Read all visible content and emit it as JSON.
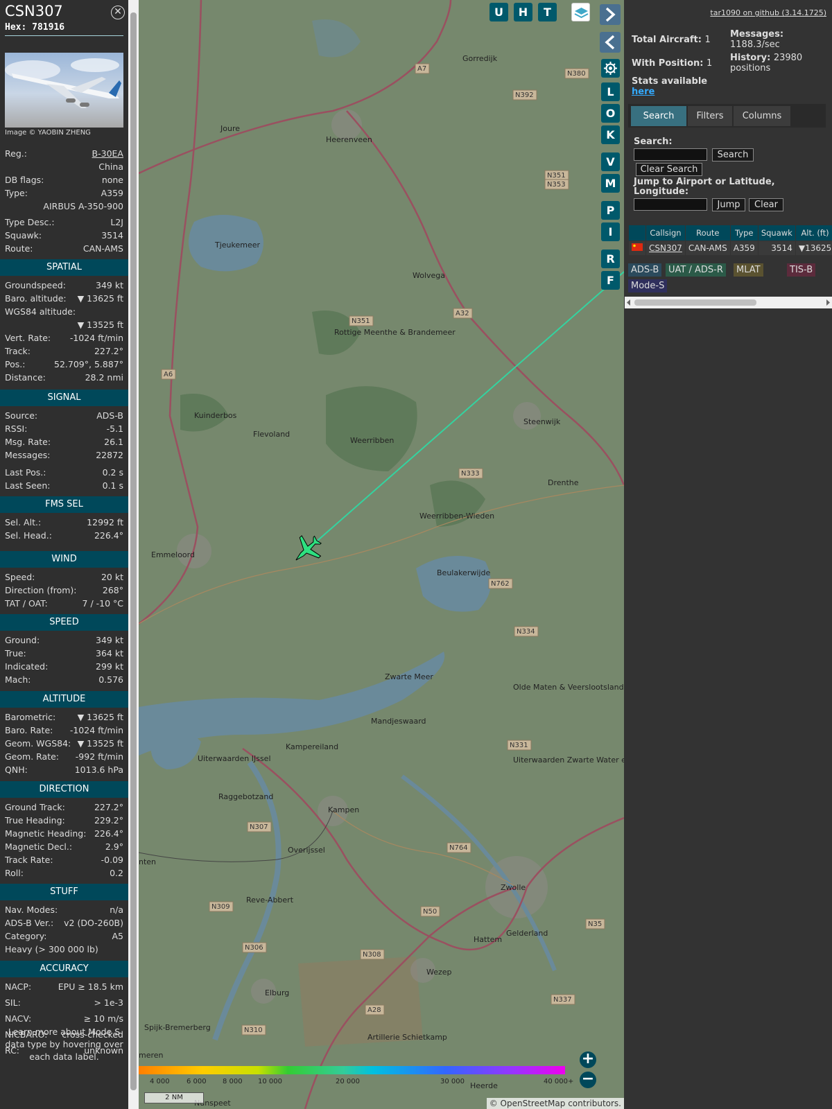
{
  "info": {
    "callsign": "CSN307",
    "hex_label": "Hex:",
    "hex": "781916",
    "close_glyph": "✕",
    "image_credit": "Image © YAOBIN ZHENG",
    "general": [
      {
        "k": "Reg.:",
        "v": "B-30EA"
      },
      {
        "k": "",
        "v": "China"
      },
      {
        "k": "DB flags:",
        "v": "none"
      },
      {
        "k": "Type:",
        "v": "A359"
      },
      {
        "k": "",
        "v": "AIRBUS A-350-900"
      },
      {
        "k": "Type Desc.:",
        "v": "L2J"
      },
      {
        "k": "Squawk:",
        "v": "3514"
      },
      {
        "k": "Route:",
        "v": "CAN-AMS"
      }
    ],
    "spatial_title": "SPATIAL",
    "spatial": [
      {
        "k": "Groundspeed:",
        "v": "349 kt"
      },
      {
        "k": "Baro. altitude:",
        "v": "▼ 13625 ft"
      },
      {
        "k": "WGS84 altitude:",
        "v": ""
      },
      {
        "k": "",
        "v": "▼ 13525 ft"
      },
      {
        "k": "Vert. Rate:",
        "v": "-1024 ft/min"
      },
      {
        "k": "Track:",
        "v": "227.2°"
      },
      {
        "k": "Pos.:",
        "v": "52.709°, 5.887°"
      },
      {
        "k": "Distance:",
        "v": "28.2 nmi"
      }
    ],
    "signal_title": "SIGNAL",
    "signal": [
      {
        "k": "Source:",
        "v": "ADS-B"
      },
      {
        "k": "RSSI:",
        "v": "-5.1"
      },
      {
        "k": "Msg. Rate:",
        "v": "26.1"
      },
      {
        "k": "Messages:",
        "v": "22872"
      },
      {
        "k": "Last Pos.:",
        "v": "0.2 s"
      },
      {
        "k": "Last Seen:",
        "v": "0.1 s"
      }
    ],
    "fms_title": "FMS SEL",
    "fms": [
      {
        "k": "Sel. Alt.:",
        "v": "12992 ft"
      },
      {
        "k": "Sel. Head.:",
        "v": "226.4°"
      }
    ],
    "wind_title": "WIND",
    "wind": [
      {
        "k": "Speed:",
        "v": "20 kt"
      },
      {
        "k": "Direction (from):",
        "v": "268°"
      },
      {
        "k": "TAT / OAT:",
        "v": "7 / -10 °C"
      }
    ],
    "speed_title": "SPEED",
    "speed": [
      {
        "k": "Ground:",
        "v": "349 kt"
      },
      {
        "k": "True:",
        "v": "364 kt"
      },
      {
        "k": "Indicated:",
        "v": "299 kt"
      },
      {
        "k": "Mach:",
        "v": "0.576"
      }
    ],
    "altitude_title": "ALTITUDE",
    "altitude": [
      {
        "k": "Barometric:",
        "v": "▼ 13625 ft"
      },
      {
        "k": "Baro. Rate:",
        "v": "-1024 ft/min"
      },
      {
        "k": "Geom. WGS84:",
        "v": "▼ 13525 ft"
      },
      {
        "k": "Geom. Rate:",
        "v": "-992 ft/min"
      },
      {
        "k": "QNH:",
        "v": "1013.6 hPa"
      }
    ],
    "direction_title": "DIRECTION",
    "direction": [
      {
        "k": "Ground Track:",
        "v": "227.2°"
      },
      {
        "k": "True Heading:",
        "v": "229.2°"
      },
      {
        "k": "Magnetic Heading:",
        "v": "226.4°"
      },
      {
        "k": "Magnetic Decl.:",
        "v": "2.9°"
      },
      {
        "k": "Track Rate:",
        "v": "-0.09"
      },
      {
        "k": "Roll:",
        "v": "0.2"
      }
    ],
    "stuff_title": "STUFF",
    "stuff": [
      {
        "k": "Nav. Modes:",
        "v": "n/a"
      },
      {
        "k": "ADS-B Ver.:",
        "v": "v2 (DO-260B)"
      },
      {
        "k": "Category:",
        "v": "A5"
      },
      {
        "k": "Heavy (> 300 000 lb)",
        "v": ""
      }
    ],
    "accuracy_title": "ACCURACY",
    "accuracy": [
      {
        "k": "NACP:",
        "v": "EPU ≥ 18.5 km"
      },
      {
        "k": "SIL:",
        "v": "> 1e-3"
      },
      {
        "k": "NACV:",
        "v": "≥ 10 m/s"
      },
      {
        "k": "NICBARO:",
        "v": "cross-checked"
      },
      {
        "k": "RC:",
        "v": "unknown"
      }
    ],
    "note": "Learn more about Mode S data type by hovering over each data label."
  },
  "map": {
    "top_buttons": [
      "U",
      "H",
      "T"
    ],
    "side_buttons": [
      "L",
      "O",
      "K",
      "V",
      "M",
      "P",
      "I",
      "R",
      "F"
    ],
    "places": [
      "Gorredijk",
      "Heerenveen",
      "Joure",
      "Tjeukemeer",
      "Wolvega",
      "Rottige Meenthe & Brandemeer",
      "Steenwijk",
      "Weerribben",
      "Kuinderbos",
      "Flevoland",
      "Weerribben-Wieden",
      "Beulakerwijde",
      "Emmeloord",
      "Drenthe",
      "Zwarte Meer",
      "Olde Maten & Veerslootslanden",
      "Mandjeswaard",
      "Kampereiland",
      "Uiterwaarden IJssel",
      "Uiterwaarden Zwarte Water en Vecht",
      "Raggebotzand",
      "Kampen",
      "Zwolle",
      "Hattem",
      "Reve-Abbert",
      "Wezep",
      "Elburg",
      "Artillerie Schietkamp",
      "Heerde",
      "Spijk-Bremerberg",
      "Nunspeet",
      "Overijssel",
      "Gelderland",
      "nten",
      "meren"
    ],
    "roads": [
      "A7",
      "N392",
      "N380",
      "N351",
      "N353",
      "A32",
      "N351",
      "A6",
      "N333",
      "N762",
      "N334",
      "N331",
      "N307",
      "N764",
      "N50",
      "N309",
      "N306",
      "N308",
      "N35",
      "N337",
      "A28",
      "N310"
    ],
    "altitude_scale": [
      "4 000",
      "6 000",
      "8 000",
      "10 000",
      "20 000",
      "30 000",
      "40 000+"
    ],
    "scale_bar": "2 NM",
    "attribution_prefix": "© ",
    "attribution_link": "OpenStreetMap",
    "attribution_suffix": " contributors.",
    "zoom_in": "+",
    "zoom_out": "−",
    "colors": {
      "water": "#6a8a9a",
      "land": "#76886d",
      "track": "#33d4a0",
      "plane": "#2ee080"
    }
  },
  "right": {
    "github_link": "tar1090 on github (3.14.1725)",
    "total_label": "Total Aircraft:",
    "total_value": "1",
    "position_label": "With Position:",
    "position_value": "1",
    "messages_label": "Messages:",
    "messages_value": "1188.3/sec",
    "history_label": "History:",
    "history_value": "23980",
    "history_unit": "positions",
    "stats_label": "Stats available",
    "stats_link": "here",
    "tabs": [
      "Search",
      "Filters",
      "Columns"
    ],
    "search_label": "Search:",
    "search_button": "Search",
    "clear_search": "Clear Search",
    "jump_label": "Jump to Airport or Latitude, Longitude:",
    "jump_button": "Jump",
    "clear_button": "Clear",
    "table_headers": [
      "Callsign",
      "Route",
      "Type",
      "Squawk",
      "Alt. (ft)"
    ],
    "table_row": {
      "callsign": "CSN307",
      "route": "CAN-AMS",
      "type": "A359",
      "squawk": "3514",
      "alt": "▼13625"
    },
    "badges": [
      {
        "label": "ADS-B",
        "color": "#2b4a5c"
      },
      {
        "label": "UAT / ADS-R",
        "color": "#2b5a48"
      },
      {
        "label": "MLAT",
        "color": "#5a5230"
      },
      {
        "label": "TIS-B",
        "color": "#5c2b3c"
      },
      {
        "label": "Mode-S",
        "color": "#2f2f5c"
      }
    ]
  }
}
